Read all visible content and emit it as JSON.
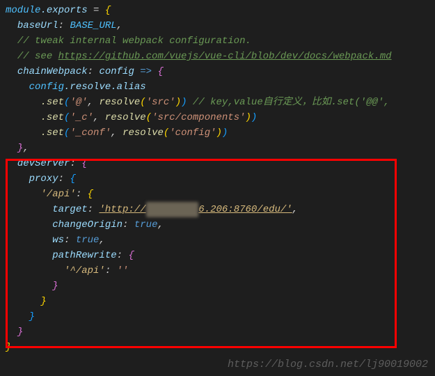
{
  "code": {
    "l1_module": "module",
    "l1_exports": ".exports",
    "l1_eq": " = ",
    "l2_prop": "baseUrl",
    "l2_colon": ": ",
    "l2_val": "BASE_URL",
    "l2_comma": ",",
    "l3_comment": "// tweak internal webpack configuration.",
    "l4_comment_pre": "// see ",
    "l4_link": "https://github.com/vuejs/vue-cli/blob/dev/docs/webpack.md",
    "l5_prop": "chainWebpack",
    "l5_colon": ": ",
    "l5_param": "config",
    "l5_arrow": " => ",
    "l6_config": "config",
    "l6_resolve": ".resolve.alias",
    "l7_set": ".set",
    "l7_arg1": "'@'",
    "l7_sep": ", ",
    "l7_resolve": "resolve",
    "l7_arg2": "'src'",
    "l7_comment": " // key,value自行定义，比如.set('@@',",
    "l8_set": ".set",
    "l8_arg1": "'_c'",
    "l8_sep": ", ",
    "l8_resolve": "resolve",
    "l8_arg2": "'src/components'",
    "l9_set": ".set",
    "l9_arg1": "'_conf'",
    "l9_sep": ", ",
    "l9_resolve": "resolve",
    "l9_arg2": "'config'",
    "l11_prop": "devServer",
    "l11_colon": ": ",
    "l12_prop": "proxy",
    "l12_colon": ": ",
    "l13_prop": "'/api'",
    "l13_colon": ": ",
    "l14_prop": "target",
    "l14_colon": ": ",
    "l14_val_pre": "'http://",
    "l14_val_post": "6.206:8760/edu/'",
    "l14_comma": ",",
    "l15_prop": "changeOrigin",
    "l15_colon": ": ",
    "l15_val": "true",
    "l15_comma": ",",
    "l16_prop": "ws",
    "l16_colon": ": ",
    "l16_val": "true",
    "l16_comma": ",",
    "l17_prop": "pathRewrite",
    "l17_colon": ": ",
    "l18_key": "'^/api'",
    "l18_colon": ": ",
    "l18_val": "''"
  },
  "watermark": "https://blog.csdn.net/lj90019002"
}
